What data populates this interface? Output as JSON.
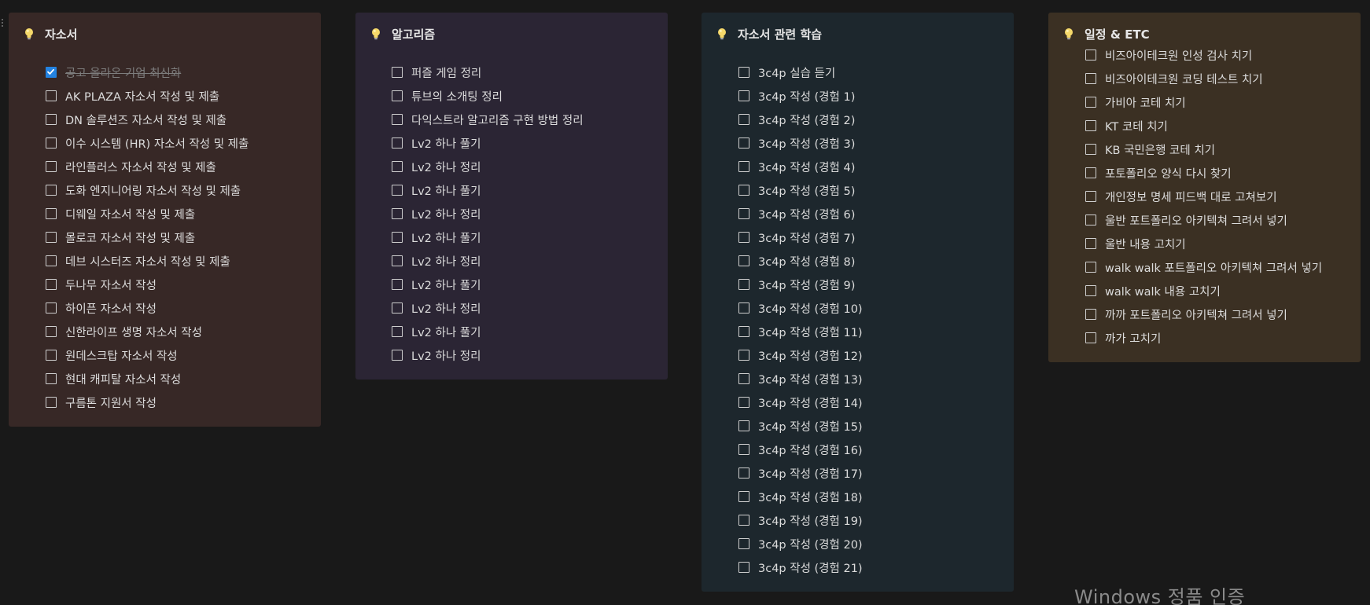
{
  "callouts": [
    {
      "icon": "lightbulb-icon",
      "title": "자소서",
      "bg": "#372826",
      "items": [
        {
          "label": "공고 올라온 기업 최신화",
          "checked": true
        },
        {
          "label": "AK PLAZA 자소서 작성 및 제출",
          "checked": false
        },
        {
          "label": "DN 솔루션즈 자소서 작성 및 제출",
          "checked": false
        },
        {
          "label": "이수 시스템 (HR) 자소서 작성 및 제출",
          "checked": false
        },
        {
          "label": "라인플러스 자소서 작성 및 제출",
          "checked": false
        },
        {
          "label": "도화 엔지니어링 자소서 작성 및 제출",
          "checked": false
        },
        {
          "label": "디웨일 자소서 작성 및 제출",
          "checked": false
        },
        {
          "label": "몰로코 자소서 작성 및 제출",
          "checked": false
        },
        {
          "label": "데브 시스터즈 자소서 작성 및 제출",
          "checked": false
        },
        {
          "label": "두나무 자소서 작성",
          "checked": false
        },
        {
          "label": "하이픈 자소서 작성",
          "checked": false
        },
        {
          "label": "신한라이프 생명 자소서 작성",
          "checked": false
        },
        {
          "label": "원데스크탑 자소서 작성",
          "checked": false
        },
        {
          "label": "현대 캐피탈 자소서 작성",
          "checked": false
        },
        {
          "label": "구름톤 지원서 작성",
          "checked": false
        }
      ]
    },
    {
      "icon": "lightbulb-icon",
      "title": "알고리즘",
      "bg": "#2b2534",
      "items": [
        {
          "label": "퍼즐 게임 정리",
          "checked": false
        },
        {
          "label": "튜브의 소개팅 정리",
          "checked": false
        },
        {
          "label": "다익스트라 알고리즘 구현 방법 정리",
          "checked": false
        },
        {
          "label": "Lv2 하나 풀기",
          "checked": false
        },
        {
          "label": "Lv2 하나 정리",
          "checked": false
        },
        {
          "label": "Lv2 하나 풀기",
          "checked": false
        },
        {
          "label": "Lv2 하나 정리",
          "checked": false
        },
        {
          "label": "Lv2 하나 풀기",
          "checked": false
        },
        {
          "label": "Lv2 하나 정리",
          "checked": false
        },
        {
          "label": "Lv2 하나 풀기",
          "checked": false
        },
        {
          "label": "Lv2 하나 정리",
          "checked": false
        },
        {
          "label": " Lv2 하나 풀기",
          "checked": false
        },
        {
          "label": "Lv2 하나 정리",
          "checked": false
        }
      ]
    },
    {
      "icon": "lightbulb-icon",
      "title": "자소서 관련 학습",
      "bg": "#1d272d",
      "items": [
        {
          "label": "3c4p 실습 듣기",
          "checked": false
        },
        {
          "label": "3c4p 작성 (경험 1)",
          "checked": false
        },
        {
          "label": "3c4p 작성 (경험 2)",
          "checked": false
        },
        {
          "label": "3c4p 작성 (경험 3)",
          "checked": false
        },
        {
          "label": "3c4p 작성 (경험 4)",
          "checked": false
        },
        {
          "label": "3c4p 작성 (경험 5)",
          "checked": false
        },
        {
          "label": "3c4p 작성 (경험 6)",
          "checked": false
        },
        {
          "label": "3c4p 작성 (경험 7)",
          "checked": false
        },
        {
          "label": "3c4p 작성 (경험 8)",
          "checked": false
        },
        {
          "label": "3c4p 작성 (경험 9)",
          "checked": false
        },
        {
          "label": "3c4p 작성 (경험 10)",
          "checked": false
        },
        {
          "label": "3c4p 작성 (경험 11)",
          "checked": false
        },
        {
          "label": "3c4p 작성 (경험 12)",
          "checked": false
        },
        {
          "label": "3c4p 작성 (경험 13)",
          "checked": false
        },
        {
          "label": "3c4p 작성 (경험 14)",
          "checked": false
        },
        {
          "label": "3c4p 작성 (경험 15)",
          "checked": false
        },
        {
          "label": "3c4p 작성 (경험 16)",
          "checked": false
        },
        {
          "label": "3c4p 작성 (경험 17)",
          "checked": false
        },
        {
          "label": "3c4p 작성 (경험 18)",
          "checked": false
        },
        {
          "label": "3c4p 작성 (경험 19)",
          "checked": false
        },
        {
          "label": "3c4p 작성 (경험 20)",
          "checked": false
        },
        {
          "label": "3c4p 작성 (경험 21)",
          "checked": false
        }
      ]
    },
    {
      "icon": "lightbulb-icon",
      "title": "일정 & ETC",
      "bg": "#3b3023",
      "items": [
        {
          "label": "비즈아이테크원 인성 검사 치기",
          "checked": false
        },
        {
          "label": "비즈아이테크원 코딩 테스트 치기",
          "checked": false
        },
        {
          "label": "가비아 코테 치기",
          "checked": false
        },
        {
          "label": "KT 코테 치기",
          "checked": false
        },
        {
          "label": "KB 국민은행 코테 치기",
          "checked": false
        },
        {
          "label": "포토폴리오 양식 다시 찾기",
          "checked": false
        },
        {
          "label": "개인정보 명세 피드백 대로 고쳐보기",
          "checked": false
        },
        {
          "label": "울반 포트폴리오 아키텍쳐 그려서 넣기",
          "checked": false
        },
        {
          "label": "울반 내용 고치기",
          "checked": false
        },
        {
          "label": "walk walk 포트폴리오 아키텍쳐 그려서 넣기",
          "checked": false
        },
        {
          "label": "walk walk 내용 고치기",
          "checked": false
        },
        {
          "label": "까까 포트폴리오 아키텍쳐 그려서 넣기",
          "checked": false
        },
        {
          "label": "까가 고치기",
          "checked": false
        }
      ]
    }
  ],
  "watermark": "Windows 정품 인증"
}
